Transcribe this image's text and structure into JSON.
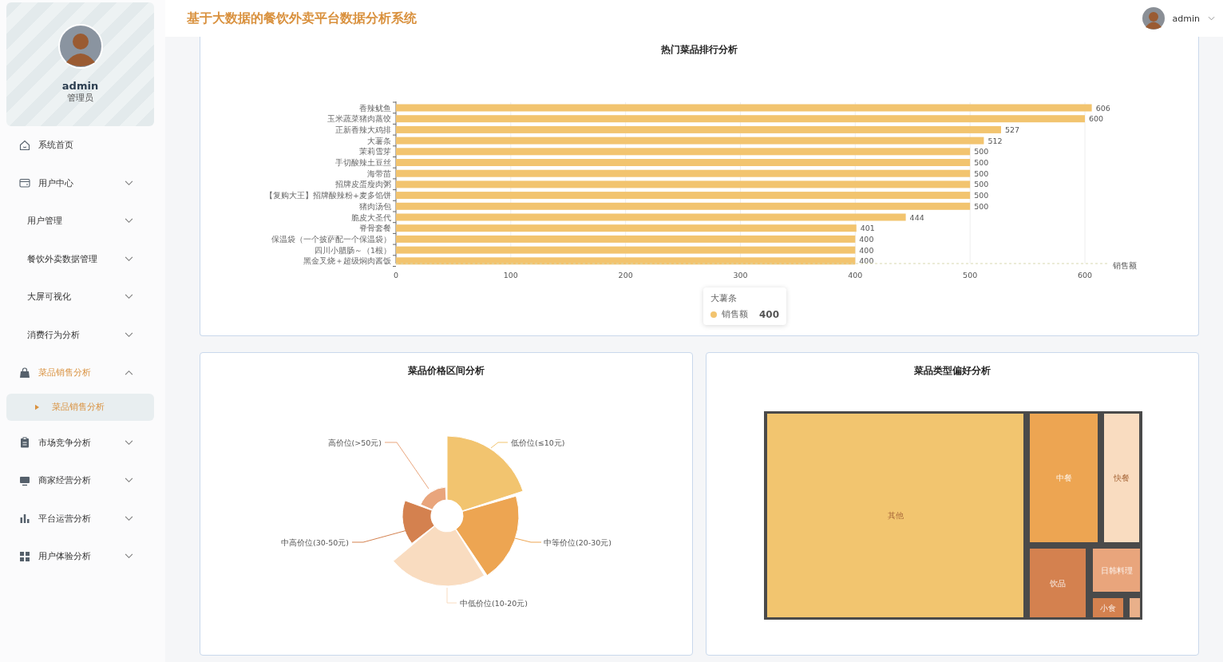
{
  "header": {
    "title": "基于大数据的餐饮外卖平台数据分析系统",
    "user": "admin"
  },
  "profile": {
    "name": "admin",
    "role": "管理员"
  },
  "menu": [
    {
      "label": "系统首页",
      "kind": "link",
      "selected": false
    },
    {
      "label": "用户中心",
      "kind": "menu",
      "expanded": false,
      "selected": false
    },
    {
      "label": "用户管理",
      "kind": "menu",
      "expanded": false,
      "selected": false
    },
    {
      "label": "餐饮外卖数据管理",
      "kind": "menu",
      "expanded": false,
      "selected": false
    },
    {
      "label": "大屏可视化",
      "kind": "menu",
      "expanded": false,
      "selected": false
    },
    {
      "label": "消费行为分析",
      "kind": "menu",
      "expanded": false,
      "selected": false
    },
    {
      "label": "菜品销售分析",
      "kind": "menu",
      "expanded": true,
      "selected": true,
      "children": [
        {
          "label": "菜品销售分析",
          "selected": true
        }
      ]
    },
    {
      "label": "市场竞争分析",
      "kind": "menu",
      "expanded": false,
      "selected": false
    },
    {
      "label": "商家经营分析",
      "kind": "menu",
      "expanded": false,
      "selected": false
    },
    {
      "label": "平台运营分析",
      "kind": "menu",
      "expanded": false,
      "selected": false
    },
    {
      "label": "用户体验分析",
      "kind": "menu",
      "expanded": false,
      "selected": false
    }
  ],
  "ranking": {
    "title": "热门菜品排行分析",
    "chart_data": {
      "type": "bar",
      "orientation": "horizontal",
      "xlabel": "销售额",
      "categories": [
        "香辣鱿鱼",
        "玉米蔬菜猪肉蒸饺",
        "正新香辣大鸡排",
        "大薯条",
        "茉莉雪芽",
        "手切酸辣土豆丝",
        "海带苗",
        "招牌皮蛋瘦肉粥",
        "【复购大王】招牌酸辣粉+麦多馅饼",
        "猪肉汤包",
        "脆皮大圣代",
        "脊骨套餐",
        "保温袋（一个披萨配一个保温袋）",
        "四川小腊肠～（1根）",
        "黑金叉烧＋超级焖肉酱饭"
      ],
      "series": [
        {
          "name": "销售额",
          "color": "#f2c46f",
          "values": [
            606,
            600,
            527,
            512,
            500,
            500,
            500,
            500,
            500,
            500,
            444,
            401,
            400,
            400,
            400
          ]
        }
      ],
      "xlim": [
        0,
        620
      ],
      "xticks": [
        0,
        100,
        200,
        300,
        400,
        500,
        600
      ],
      "grid": true,
      "data_labels": true
    },
    "tooltip": {
      "title": "大薯条",
      "value": "400"
    }
  },
  "price": {
    "title": "菜品价格区间分析",
    "slices": [
      {
        "label": "低价位(≤10元)",
        "color": "#f2c46f"
      },
      {
        "label": "中等价位(20-30元)",
        "color": "#eda552"
      },
      {
        "label": "中低价位(10-20元)",
        "color": "#f9dcc0"
      },
      {
        "label": "中高价位(30-50元)",
        "color": "#d4814f"
      },
      {
        "label": "高价位(>50元)",
        "color": "#e9a57c"
      }
    ]
  },
  "types": {
    "title": "菜品类型偏好分析",
    "cells": [
      {
        "label": "其他",
        "color": "#f2c56f"
      },
      {
        "label": "中餐",
        "color": "#eda552"
      },
      {
        "label": "快餐",
        "color": "#f9dcc0"
      },
      {
        "label": "饮品",
        "color": "#d4814f"
      },
      {
        "label": "日韩料理",
        "color": "#e9a57c"
      },
      {
        "label": "小食",
        "color": "#d4814f"
      },
      {
        "color": "#e9b08a"
      }
    ]
  }
}
